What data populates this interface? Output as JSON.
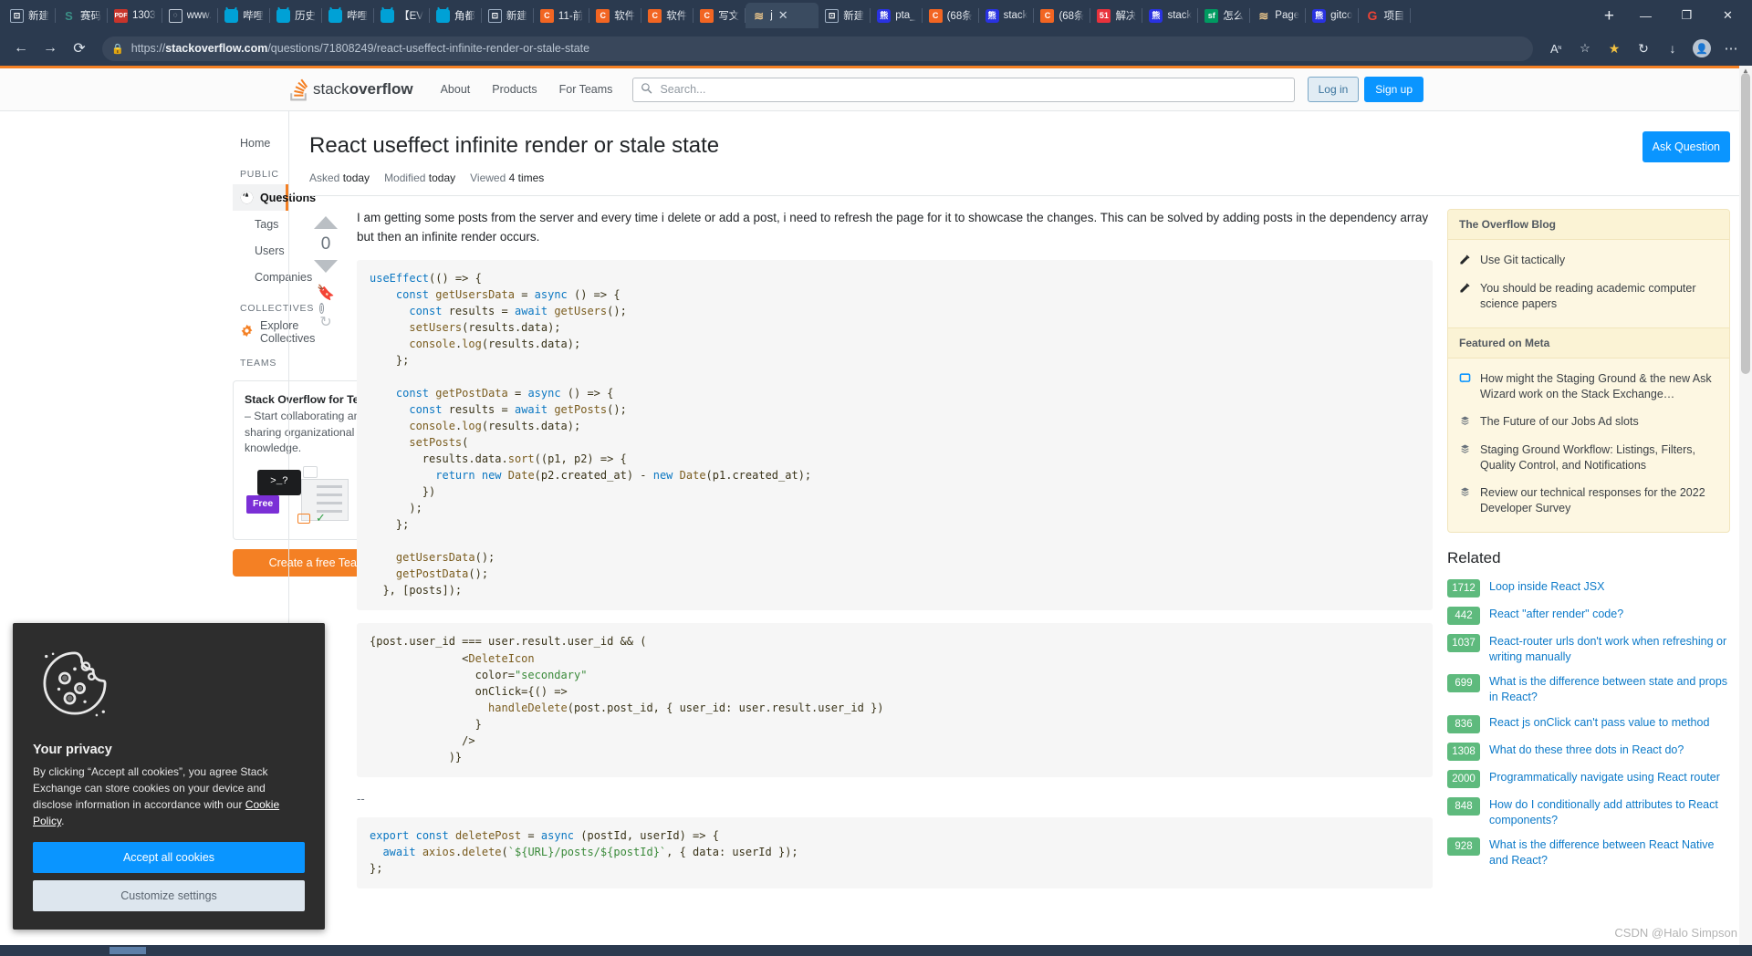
{
  "browser": {
    "tabs": [
      {
        "title": "新建",
        "icon": "document-icon",
        "favicon_class": "fav-doc",
        "glyph": "⊡",
        "active": false
      },
      {
        "title": "赛码",
        "icon": "saima-icon",
        "favicon_class": "fav-s",
        "glyph": "S",
        "active": false
      },
      {
        "title": "1303",
        "icon": "pdf-icon",
        "favicon_class": "fav-pdf",
        "glyph": "PDF",
        "active": false
      },
      {
        "title": "www.",
        "icon": "page-icon",
        "favicon_class": "fav-www",
        "glyph": "◌",
        "active": false
      },
      {
        "title": "哔哩",
        "icon": "bilibili-icon",
        "favicon_class": "fav-bili",
        "glyph": "",
        "active": false
      },
      {
        "title": "历史",
        "icon": "bilibili-icon",
        "favicon_class": "fav-bili",
        "glyph": "",
        "active": false
      },
      {
        "title": "哔哩",
        "icon": "bilibili-icon",
        "favicon_class": "fav-bili",
        "glyph": "",
        "active": false
      },
      {
        "title": "【EV",
        "icon": "bilibili-icon",
        "favicon_class": "fav-bili",
        "glyph": "",
        "active": false
      },
      {
        "title": "角都",
        "icon": "bilibili-icon",
        "favicon_class": "fav-bili",
        "glyph": "",
        "active": false
      },
      {
        "title": "新建",
        "icon": "document-icon",
        "favicon_class": "fav-doc",
        "glyph": "⊡",
        "active": false
      },
      {
        "title": "11-前",
        "icon": "csdn-icon",
        "favicon_class": "fav-c",
        "glyph": "C",
        "active": false
      },
      {
        "title": "软件",
        "icon": "csdn-icon",
        "favicon_class": "fav-c",
        "glyph": "C",
        "active": false
      },
      {
        "title": "软件",
        "icon": "csdn-icon",
        "favicon_class": "fav-c",
        "glyph": "C",
        "active": false
      },
      {
        "title": "写文",
        "icon": "csdn-icon",
        "favicon_class": "fav-c",
        "glyph": "C",
        "active": false
      },
      {
        "title": "j",
        "icon": "java-icon",
        "favicon_class": "fav-java",
        "glyph": "≋",
        "active": true
      },
      {
        "title": "新建",
        "icon": "document-icon",
        "favicon_class": "fav-doc",
        "glyph": "⊡",
        "active": false
      },
      {
        "title": "pta_",
        "icon": "baidu-icon",
        "favicon_class": "fav-baidu",
        "glyph": "熊",
        "active": false
      },
      {
        "title": "(68条",
        "icon": "csdn-icon",
        "favicon_class": "fav-c",
        "glyph": "C",
        "active": false
      },
      {
        "title": "stack",
        "icon": "baidu-icon",
        "favicon_class": "fav-baidu",
        "glyph": "熊",
        "active": false
      },
      {
        "title": "(68条",
        "icon": "csdn-icon",
        "favicon_class": "fav-c",
        "glyph": "C",
        "active": false
      },
      {
        "title": "解决",
        "icon": "51cto-icon",
        "favicon_class": "fav-51",
        "glyph": "51",
        "active": false
      },
      {
        "title": "stack",
        "icon": "baidu-icon",
        "favicon_class": "fav-baidu",
        "glyph": "熊",
        "active": false
      },
      {
        "title": "怎么",
        "icon": "segmentfault-icon",
        "favicon_class": "fav-sf",
        "glyph": "sf",
        "active": false
      },
      {
        "title": "Page",
        "icon": "java-icon",
        "favicon_class": "fav-java",
        "glyph": "≋",
        "active": false
      },
      {
        "title": "gitco",
        "icon": "baidu-icon",
        "favicon_class": "fav-baidu",
        "glyph": "熊",
        "active": false
      },
      {
        "title": "项目",
        "icon": "google-icon",
        "favicon_class": "fav-g",
        "glyph": "G",
        "active": false
      }
    ],
    "new_tab_label": "+",
    "window_controls": {
      "minimize": "—",
      "restore": "❐",
      "close": "✕"
    },
    "nav": {
      "back": "←",
      "forward": "→",
      "reload": "⟳"
    },
    "url_prefix": "https://",
    "url_domain": "stackoverflow.com",
    "url_path": "/questions/71808249/react-useffect-infinite-render-or-stale-state",
    "toolbar_right": [
      "Aᴺ",
      "☆+",
      "★",
      "↻",
      "↓",
      "⋯"
    ]
  },
  "so_header": {
    "logo_text_light": "stack",
    "logo_text_bold": "overflow",
    "links": [
      "About",
      "Products",
      "For Teams"
    ],
    "search_placeholder": "Search...",
    "login_label": "Log in",
    "signup_label": "Sign up"
  },
  "sidebar": {
    "home_label": "Home",
    "public_header": "PUBLIC",
    "items": [
      {
        "label": "Questions",
        "icon": "globe-icon",
        "active": true
      },
      {
        "label": "Tags",
        "icon": "",
        "active": false
      },
      {
        "label": "Users",
        "icon": "",
        "active": false
      },
      {
        "label": "Companies",
        "icon": "",
        "active": false
      }
    ],
    "collectives_header": "COLLECTIVES",
    "collectives_item": "Explore Collectives",
    "teams_header": "TEAMS",
    "teams_card": {
      "title": "Stack Overflow for Teams",
      "body": " – Start collaborating and sharing organizational knowledge.",
      "terminal_glyph": ">_?",
      "free_badge": "Free",
      "cta_label": "Create a free Team"
    }
  },
  "question": {
    "title": "React useffect infinite render or stale state",
    "ask_button": "Ask Question",
    "meta": [
      {
        "label": "Asked",
        "value": "today"
      },
      {
        "label": "Modified",
        "value": "today"
      },
      {
        "label": "Viewed",
        "value": "4 times"
      }
    ],
    "vote_count": "0",
    "body_paragraph": "I am getting some posts from the server and every time i delete or add a post, i need to refresh the page for it to showcase the changes. This can be solved by adding posts in the dependency array but then an infinite render occurs.",
    "code_block_1": "useEffect(() => {\n    const getUsersData = async () => {\n      const results = await getUsers();\n      setUsers(results.data);\n      console.log(results.data);\n    };\n\n    const getPostData = async () => {\n      const results = await getPosts();\n      console.log(results.data);\n      setPosts(\n        results.data.sort((p1, p2) => {\n          return new Date(p2.created_at) - new Date(p1.created_at);\n        })\n      );\n    };\n\n    getUsersData();\n    getPostData();\n  }, [posts]);",
    "code_block_2": "{post.user_id === user.result.user_id && (\n              <DeleteIcon\n                color=\"secondary\"\n                onClick={() =>\n                  handleDelete(post.post_id, { user_id: user.result.user_id })\n                }\n              />\n            )}",
    "separator": "--",
    "code_block_3": "export const deletePost = async (postId, userId) => {\n  await axios.delete(`${URL}/posts/${postId}`, { data: userId });\n};"
  },
  "blog_panel": {
    "title": "The Overflow Blog",
    "items": [
      {
        "icon": "pencil-icon",
        "text": "Use Git tactically"
      },
      {
        "icon": "pencil-icon",
        "text": "You should be reading academic computer science papers"
      }
    ]
  },
  "meta_panel": {
    "title": "Featured on Meta",
    "items": [
      {
        "icon": "meta-comment-icon",
        "text": "How might the Staging Ground & the new Ask Wizard work on the Stack Exchange…"
      },
      {
        "icon": "stacks-icon",
        "text": "The Future of our Jobs Ad slots"
      },
      {
        "icon": "stacks-icon",
        "text": "Staging Ground Workflow: Listings, Filters, Quality Control, and Notifications"
      },
      {
        "icon": "stacks-icon",
        "text": "Review our technical responses for the 2022 Developer Survey"
      }
    ]
  },
  "related": {
    "title": "Related",
    "items": [
      {
        "score": "1712",
        "text": "Loop inside React JSX"
      },
      {
        "score": "442",
        "text": "React \"after render\" code?"
      },
      {
        "score": "1037",
        "text": "React-router urls don't work when refreshing or writing manually"
      },
      {
        "score": "699",
        "text": "What is the difference between state and props in React?"
      },
      {
        "score": "836",
        "text": "React js onClick can't pass value to method"
      },
      {
        "score": "1308",
        "text": "What do these three dots in React do?"
      },
      {
        "score": "2000",
        "text": "Programmatically navigate using React router"
      },
      {
        "score": "848",
        "text": "How do I conditionally add attributes to React components?"
      },
      {
        "score": "928",
        "text": "What is the difference between React Native and React?"
      }
    ]
  },
  "cookie_dialog": {
    "icon": "cookie-icon",
    "title": "Your privacy",
    "body_before_link": "By clicking “Accept all cookies”, you agree Stack Exchange can store cookies on your device and disclose information in accordance with our ",
    "link_text": "Cookie Policy",
    "body_after_link": ".",
    "accept_label": "Accept all cookies",
    "customize_label": "Customize settings"
  },
  "watermark": "CSDN @Halo Simpson",
  "colors": {
    "accent_orange": "#f48024",
    "link_blue": "#0c7ac9",
    "button_blue": "#0a95ff",
    "score_green": "#5eba7d",
    "panel_yellow": "#fdf7e2",
    "chrome_navy": "#2b3a4f"
  }
}
